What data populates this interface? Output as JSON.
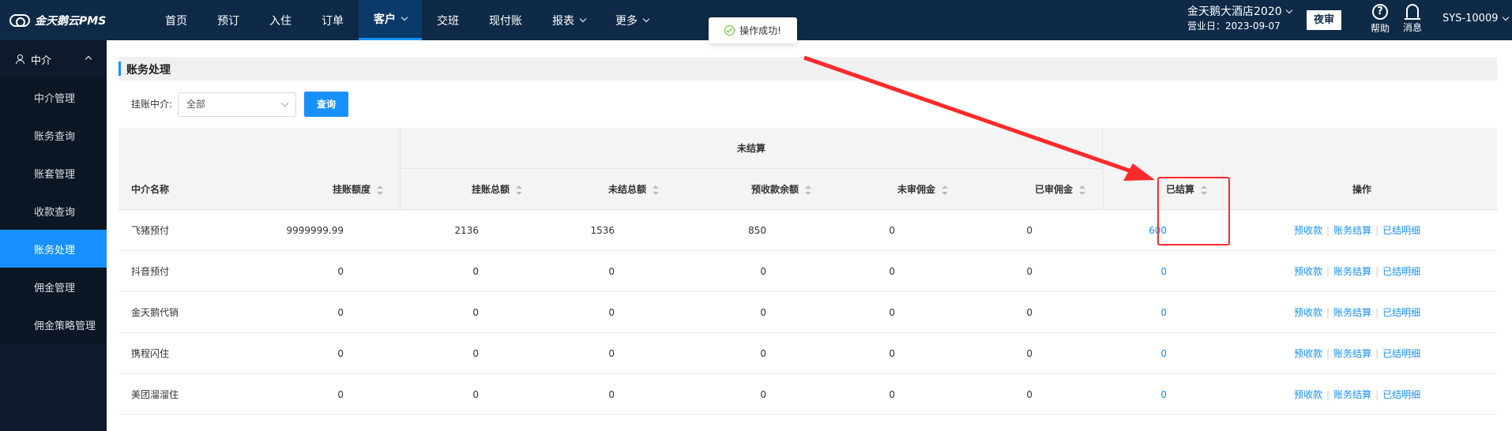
{
  "app": {
    "logo_text": "金天鹅云PMS"
  },
  "nav": {
    "items": [
      {
        "label": "首页"
      },
      {
        "label": "预订"
      },
      {
        "label": "入住"
      },
      {
        "label": "订单"
      },
      {
        "label": "客户"
      },
      {
        "label": "交班"
      },
      {
        "label": "现付账"
      },
      {
        "label": "报表"
      },
      {
        "label": "更多"
      }
    ],
    "active": "客户"
  },
  "header": {
    "hotel_name": "金天鹅大酒店2020",
    "business_date": "营业日：2023-09-07",
    "night_audit": "夜审",
    "help": "帮助",
    "messages": "消息",
    "user": "SYS-10009"
  },
  "sidebar": {
    "group": "中介",
    "items": [
      {
        "label": "中介管理"
      },
      {
        "label": "账务查询"
      },
      {
        "label": "账套管理"
      },
      {
        "label": "收款查询"
      },
      {
        "label": "账务处理"
      },
      {
        "label": "佣金管理"
      },
      {
        "label": "佣金策略管理"
      }
    ],
    "active": "账务处理"
  },
  "page": {
    "title": "账务处理",
    "filter_label": "挂账中介:",
    "filter_value": "全部",
    "query_button": "查询"
  },
  "toast": {
    "message": "操作成功!"
  },
  "table": {
    "group_header": "未结算",
    "columns": [
      "中介名称",
      "挂账额度",
      "挂账总额",
      "未结总额",
      "预收款余额",
      "未审佣金",
      "已审佣金",
      "已结算",
      "操作"
    ],
    "rows": [
      {
        "name": "飞猪预付",
        "limit": "9999999.99",
        "total": "2136",
        "unsettled": "1536",
        "prepaid": "850",
        "unreviewed": "0",
        "reviewed": "0",
        "settled": "600"
      },
      {
        "name": "抖音预付",
        "limit": "0",
        "total": "0",
        "unsettled": "0",
        "prepaid": "0",
        "unreviewed": "0",
        "reviewed": "0",
        "settled": "0"
      },
      {
        "name": "金天鹅代销",
        "limit": "0",
        "total": "0",
        "unsettled": "0",
        "prepaid": "0",
        "unreviewed": "0",
        "reviewed": "0",
        "settled": "0"
      },
      {
        "name": "携程闪住",
        "limit": "0",
        "total": "0",
        "unsettled": "0",
        "prepaid": "0",
        "unreviewed": "0",
        "reviewed": "0",
        "settled": "0"
      },
      {
        "name": "美团溜溜住",
        "limit": "0",
        "total": "0",
        "unsettled": "0",
        "prepaid": "0",
        "unreviewed": "0",
        "reviewed": "0",
        "settled": "0"
      }
    ],
    "actions": [
      "预收款",
      "账务结算",
      "已结明细"
    ]
  },
  "colors": {
    "accent": "#1890ff",
    "nav_bg": "#0e2a47",
    "annotation": "#ff2a2a"
  }
}
